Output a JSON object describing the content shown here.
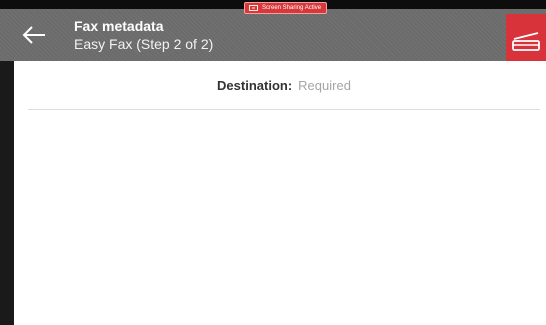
{
  "colors": {
    "header_bg": "#6b6b6b",
    "accent": "#d8323b",
    "placeholder": "#a5a5a5",
    "label": "#333333"
  },
  "header": {
    "title": "Fax metadata",
    "subtitle": "Easy Fax (Step 2 of 2)",
    "back_icon": "arrow-left-icon",
    "action_icon": "scanner-icon"
  },
  "screen_share": {
    "label": "Screen Sharing Active",
    "icon": "screen-share-icon"
  },
  "form": {
    "destination": {
      "label": "Destination:",
      "value": "Required"
    }
  }
}
